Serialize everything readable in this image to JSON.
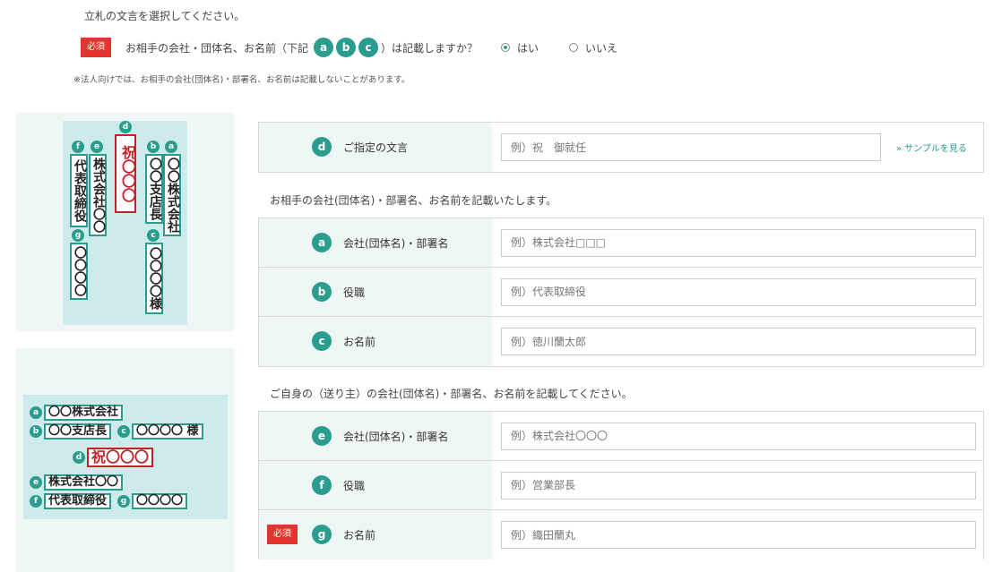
{
  "intro": "立札の文言を選択してください。",
  "question": {
    "required_label": "必須",
    "text_before": "お相手の会社・団体名、お名前（下記",
    "markers": [
      "a",
      "b",
      "c"
    ],
    "text_after": "）は記載しますか？",
    "options": [
      {
        "label": "はい",
        "selected": true
      },
      {
        "label": "いいえ",
        "selected": false
      }
    ]
  },
  "note": "※法人向けでは、お相手の会社(団体名)・部署名、お名前は記載しないことがあります。",
  "vertical_sample": {
    "d": {
      "marker": "d",
      "text": "祝〇〇〇"
    },
    "e": {
      "marker": "e",
      "text": "株式会社〇〇"
    },
    "f": {
      "marker": "f",
      "text": "代表取締役"
    },
    "b": {
      "marker": "b",
      "text": "〇〇支店長"
    },
    "a": {
      "marker": "a",
      "text": "〇〇株式会社"
    },
    "g": {
      "marker": "g",
      "text": "〇〇〇〇"
    },
    "c": {
      "marker": "c",
      "text": "〇〇〇〇様"
    }
  },
  "horizontal_sample": {
    "a": {
      "marker": "a",
      "text": "〇〇株式会社"
    },
    "b": {
      "marker": "b",
      "text": "〇〇支店長"
    },
    "c": {
      "marker": "c",
      "text": "〇〇〇〇 様"
    },
    "d": {
      "marker": "d",
      "text": "祝〇〇〇"
    },
    "e": {
      "marker": "e",
      "text": "株式会社〇〇"
    },
    "f": {
      "marker": "f",
      "text": "代表取締役"
    },
    "g": {
      "marker": "g",
      "text": "〇〇〇〇"
    }
  },
  "form_message": {
    "marker": "d",
    "label": "ご指定の文言",
    "placeholder": "例）祝　御就任",
    "sample_link": "» サンプルを見る"
  },
  "recipient_section": {
    "heading": "お相手の会社(団体名)・部署名、お名前を記載いたします。",
    "rows": [
      {
        "marker": "a",
        "label": "会社(団体名)・部署名",
        "placeholder": "例）株式会社□□□"
      },
      {
        "marker": "b",
        "label": "役職",
        "placeholder": "例）代表取締役"
      },
      {
        "marker": "c",
        "label": "お名前",
        "placeholder": "例）徳川蘭太郎"
      }
    ]
  },
  "sender_section": {
    "heading": "ご自身の（送り主）の会社(団体名)・部署名、お名前を記載してください。",
    "rows": [
      {
        "marker": "e",
        "label": "会社(団体名)・部署名",
        "placeholder": "例）株式会社〇〇〇"
      },
      {
        "marker": "f",
        "label": "役職",
        "placeholder": "例）営業部長"
      },
      {
        "marker": "g",
        "label": "お名前",
        "placeholder": "例）織田蘭丸",
        "required_label": "必須"
      }
    ]
  },
  "colors": {
    "accent": "#2a9d8f",
    "required": "#e8322f",
    "label_bg": "#eef7f6",
    "highlight": "#c8202a"
  }
}
